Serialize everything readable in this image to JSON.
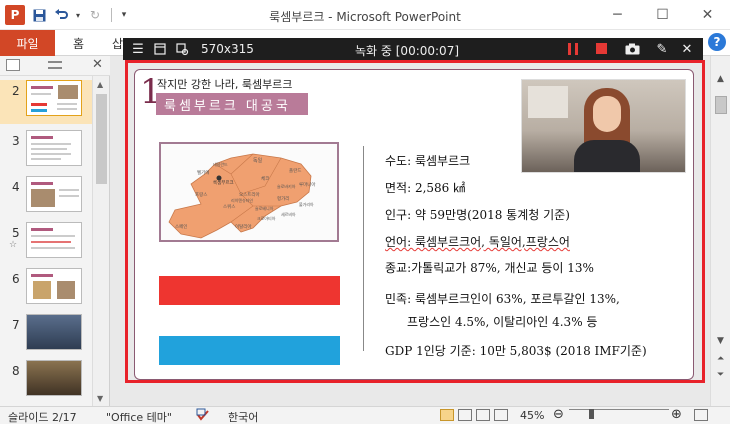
{
  "app": {
    "logo_letter": "P",
    "title": "룩셈부르크  -  Microsoft PowerPoint",
    "window_controls": [
      "─",
      "☐",
      "✕"
    ]
  },
  "quick_access": {
    "save_icon": "save-icon",
    "undo_icon": "undo-icon",
    "redo_icon": "redo-icon"
  },
  "ribbon": {
    "file_tab": "파일",
    "home_tab": "홈",
    "insert_tab": "삽",
    "help": "?"
  },
  "recorder": {
    "size": "570x315",
    "status": "녹화 중 [00:00:07]",
    "record_color": "#e53935"
  },
  "thumbnails": [
    {
      "num": "2",
      "selected": true
    },
    {
      "num": "3"
    },
    {
      "num": "4"
    },
    {
      "num": "5",
      "has_star": true
    },
    {
      "num": "6"
    },
    {
      "num": "7"
    },
    {
      "num": "8"
    }
  ],
  "slide": {
    "number": "1",
    "subtitle": "작지만 강한 나라, 룩셈부르크",
    "title": "룩셈부르크 대공국",
    "map_labels": [
      "독일",
      "룩셈부르크",
      "벨기에",
      "프랑스",
      "스위스",
      "오스트리아",
      "리히텐슈타인",
      "슬로베니아",
      "헝가리",
      "크로아티아",
      "이탈리아",
      "폴란드",
      "체코",
      "슬로바키아",
      "루마니아",
      "세르비아",
      "불가리아",
      "스페인",
      "네덜란드"
    ],
    "flag_colors": {
      "red": "#ee3530",
      "white": "#ffffff",
      "blue": "#21a2dc"
    },
    "info": {
      "capital": "수도: 룩셈부르크",
      "area": "면적: 2,586 ㎢",
      "population": "인구: 약 59만명(2018  통계청 기준)",
      "language": "언어: 룩셈부르크어, 독일어,프랑스어",
      "religion": "종교:가톨릭교가 87%, 개신교 등이 13%",
      "ethnicity_1": "민족: 룩셈부르크인이 63%, 포르투갈인 13%,",
      "ethnicity_2": "프랑스인 4.5%, 이탈리아인 4.3% 등",
      "gdp": "GDP 1인당 기준: 10만 5,803$ (2018  IMF기준)"
    }
  },
  "statusbar": {
    "slide_info": "슬라이드 2/17",
    "theme": "\"Office 테마\"",
    "language": "한국어",
    "zoom": "45%",
    "zoom_out": "⊖",
    "zoom_in": "⊕"
  }
}
